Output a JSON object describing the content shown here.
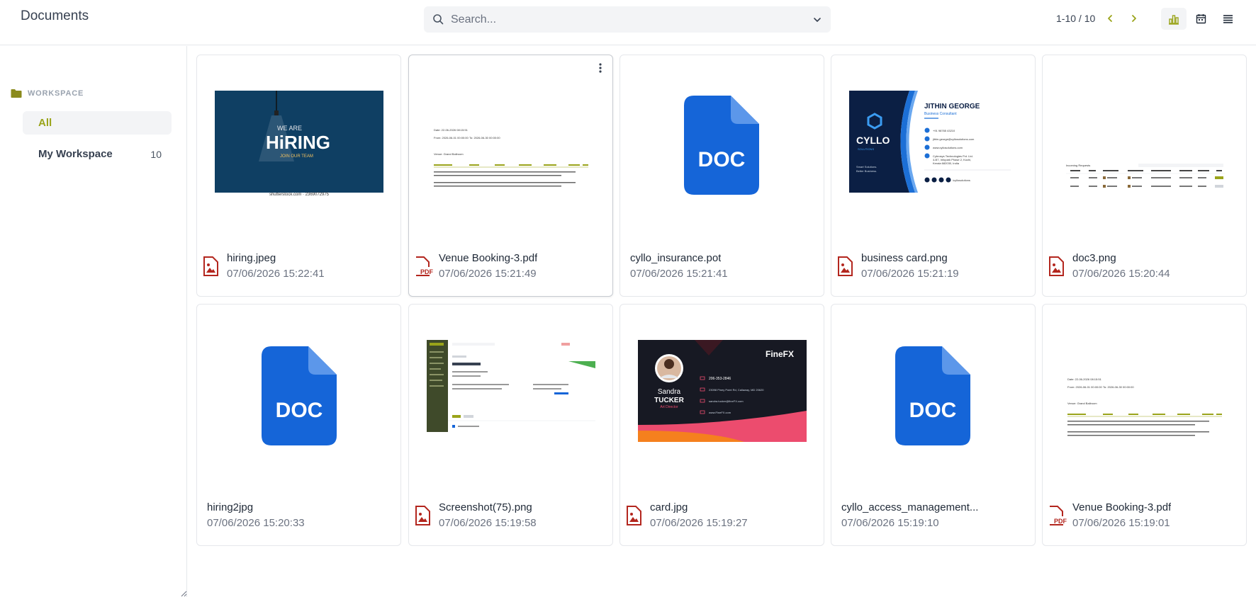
{
  "header": {
    "title": "Documents",
    "search_placeholder": "Search...",
    "pager": "1-10 / 10"
  },
  "colors": {
    "accent": "#9aa41a",
    "pdf_red": "#c0392b",
    "doc_blue": "#1565d8"
  },
  "sidebar": {
    "section": "WORKSPACE",
    "items": [
      {
        "label": "All",
        "count": ""
      },
      {
        "label": "My Workspace",
        "count": "10"
      }
    ]
  },
  "documents": [
    {
      "name": "hiring.jpeg",
      "date": "07/06/2026 15:22:41",
      "type": "image",
      "thumb": "hiring-image"
    },
    {
      "name": "Venue Booking-3.pdf",
      "date": "07/06/2026 15:21:49",
      "type": "pdf",
      "thumb": "pdf-table"
    },
    {
      "name": "cyllo_insurance.pot",
      "date": "07/06/2026 15:21:41",
      "type": "none",
      "thumb": "doc-icon"
    },
    {
      "name": "business card.png",
      "date": "07/06/2026 15:21:19",
      "type": "image",
      "thumb": "business-card"
    },
    {
      "name": "doc3.png",
      "date": "07/06/2026 15:20:44",
      "type": "image",
      "thumb": "table-screenshot"
    },
    {
      "name": "hiring2jpg",
      "date": "07/06/2026 15:20:33",
      "type": "none",
      "thumb": "doc-icon"
    },
    {
      "name": "Screenshot(75).png",
      "date": "07/06/2026 15:19:58",
      "type": "image",
      "thumb": "app-screenshot"
    },
    {
      "name": "card.jpg",
      "date": "07/06/2026 15:19:27",
      "type": "image",
      "thumb": "finefx-card"
    },
    {
      "name": "cyllo_access_management...",
      "date": "07/06/2026 15:19:10",
      "type": "none",
      "thumb": "doc-icon"
    },
    {
      "name": "Venue Booking-3.pdf",
      "date": "07/06/2026 15:19:01",
      "type": "pdf",
      "thumb": "pdf-table"
    }
  ],
  "thumb_text": {
    "hiring_we_are": "WE ARE",
    "hiring_big": "HiRING",
    "hiring_sub": "JOIN OUR TEAM",
    "hiring_credit": "shutterstock.com · 2369072975",
    "doc_label": "DOC",
    "bc_name": "JITHIN GEORGE",
    "bc_role": "Business Consultant",
    "bc_brand": "CYLLO",
    "bc_brand_sub": "SOLUTIONS",
    "bc_tagline1": "Smart Solutions.",
    "bc_tagline2": "Better Business.",
    "bc_phone": "+91 98765 43210",
    "bc_email": "jithin.george@cyllosolutions.com",
    "bc_web": "www.cyllosolutions.com",
    "bc_addr1": "Cybrosys Technologies Pvt. Ltd.",
    "bc_addr2": "4-B7, Infopark Phase 2, Kochi,",
    "bc_addr3": "Kerala 682030, India",
    "bc_social": "/cyllosolutions",
    "ff_brand": "FineFX",
    "ff_first": "Sandra",
    "ff_last": "TUCKER",
    "ff_role": "Art Director",
    "ff_phone": "206-353-2846",
    "ff_addr": "23098 Piney Point Rd, Callaway, MD 20620",
    "ff_email": "sandra.tucker@fineFX.com",
    "ff_web": "www.FineFX.com",
    "pdf_date": "Date: 22-06-2026 08:15:51",
    "pdf_from": "From: 2026-06-01 00:00:00",
    "pdf_to": "To: 2026-06-30 00:00:00",
    "pdf_venue": "Venue: Grand Ballroom",
    "doc3_title": "Incoming Requests"
  }
}
